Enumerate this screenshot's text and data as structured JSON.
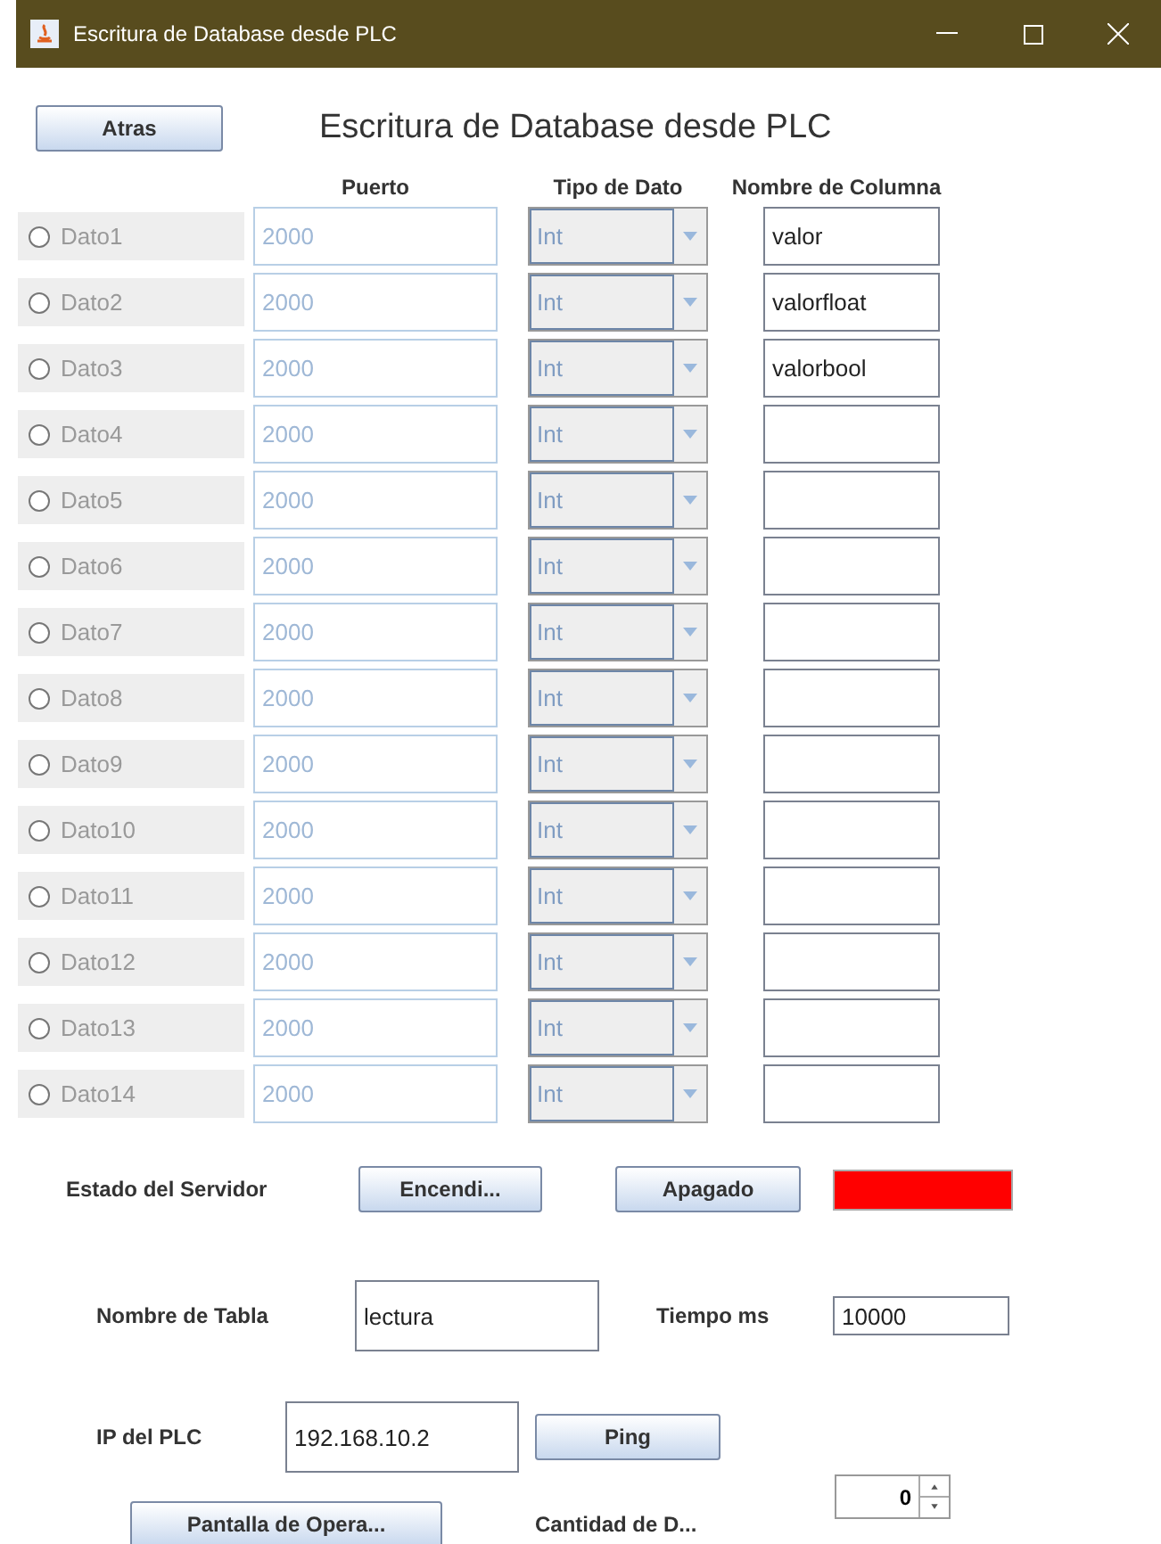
{
  "window": {
    "title": "Escritura de Database desde PLC"
  },
  "back_button": "Atras",
  "heading": "Escritura de Database desde PLC",
  "columns": [
    "Puerto",
    "Tipo de Dato",
    "Nombre de Columna"
  ],
  "rows": [
    {
      "label": "Dato1",
      "selected": false,
      "disabled": true,
      "port": "2000",
      "type": "Int",
      "column": "valor"
    },
    {
      "label": "Dato2",
      "selected": false,
      "disabled": true,
      "port": "2000",
      "type": "Int",
      "column": "valorfloat"
    },
    {
      "label": "Dato3",
      "selected": false,
      "disabled": true,
      "port": "2000",
      "type": "Int",
      "column": "valorbool"
    },
    {
      "label": "Dato4",
      "selected": false,
      "disabled": true,
      "port": "2000",
      "type": "Int"
    },
    {
      "label": "Dato5",
      "selected": false,
      "disabled": true,
      "port": "2000",
      "type": "Int"
    },
    {
      "label": "Dato6",
      "selected": false,
      "disabled": true,
      "port": "2000",
      "type": "Int"
    },
    {
      "label": "Dato7",
      "selected": false,
      "disabled": true,
      "port": "2000",
      "type": "Int"
    },
    {
      "label": "Dato8",
      "selected": false,
      "disabled": true,
      "port": "2000",
      "type": "Int"
    },
    {
      "label": "Dato9",
      "selected": false,
      "disabled": true,
      "port": "2000",
      "type": "Int"
    },
    {
      "label": "Dato10",
      "selected": false,
      "disabled": true,
      "port": "2000",
      "type": "Int"
    },
    {
      "label": "Dato11",
      "selected": false,
      "disabled": true,
      "port": "2000",
      "type": "Int"
    },
    {
      "label": "Dato12",
      "selected": false,
      "disabled": true,
      "port": "2000",
      "type": "Int"
    },
    {
      "label": "Dato13",
      "selected": false,
      "disabled": true,
      "port": "2000",
      "type": "Int"
    },
    {
      "label": "Dato14",
      "selected": false,
      "disabled": true,
      "port": "2000",
      "type": "Int"
    }
  ],
  "server": {
    "label": "Estado del Servidor",
    "on_button": "Encendi...",
    "off_button": "Apagado",
    "indicator": {
      "color": "#ff0000"
    }
  },
  "table_name": {
    "label": "Nombre de Tabla",
    "value": "lectura"
  },
  "time": {
    "label": "Tiempo ms",
    "value": "10000"
  },
  "plc_ip": {
    "label": "IP del PLC",
    "value": "192.168.10.2"
  },
  "ping_button": "Ping",
  "count": {
    "value": "0"
  },
  "operator_button": "Pantalla de Opera...",
  "count_label": "Cantidad de D..."
}
